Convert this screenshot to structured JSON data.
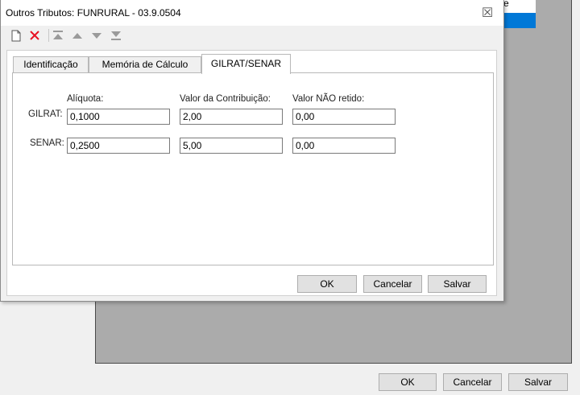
{
  "background_window": {
    "list_fragment": "e",
    "buttons": {
      "ok": "OK",
      "cancel": "Cancelar",
      "save": "Salvar"
    }
  },
  "dialog": {
    "title": "Outros Tributos: FUNRURAL - 03.9.0504",
    "close_glyph": "☒",
    "toolbar": [
      "new-document-icon",
      "delete-icon",
      "move-first-icon",
      "move-up-icon",
      "move-down-icon",
      "move-last-icon"
    ],
    "tabs": [
      {
        "label": "Identificação",
        "active": false
      },
      {
        "label": "Memória de Cálculo",
        "active": false
      },
      {
        "label": "GILRAT/SENAR",
        "active": true
      }
    ],
    "columns": {
      "aliquota": "Alíquota:",
      "valor_contribuicao": "Valor da Contribuição:",
      "valor_nao_retido": "Valor NÃO retido:"
    },
    "rows": [
      {
        "label": "GILRAT:",
        "aliquota": "0,1000",
        "valor_contribuicao": "2,00",
        "valor_nao_retido": "0,00"
      },
      {
        "label": "SENAR:",
        "aliquota": "0,2500",
        "valor_contribuicao": "5,00",
        "valor_nao_retido": "0,00"
      }
    ],
    "buttons": {
      "ok": "OK",
      "cancel": "Cancelar",
      "save": "Salvar"
    }
  },
  "colors": {
    "selection_blue": "#0078d7",
    "delete_red": "#e81123",
    "nav_gray": "#9a9a9a"
  }
}
